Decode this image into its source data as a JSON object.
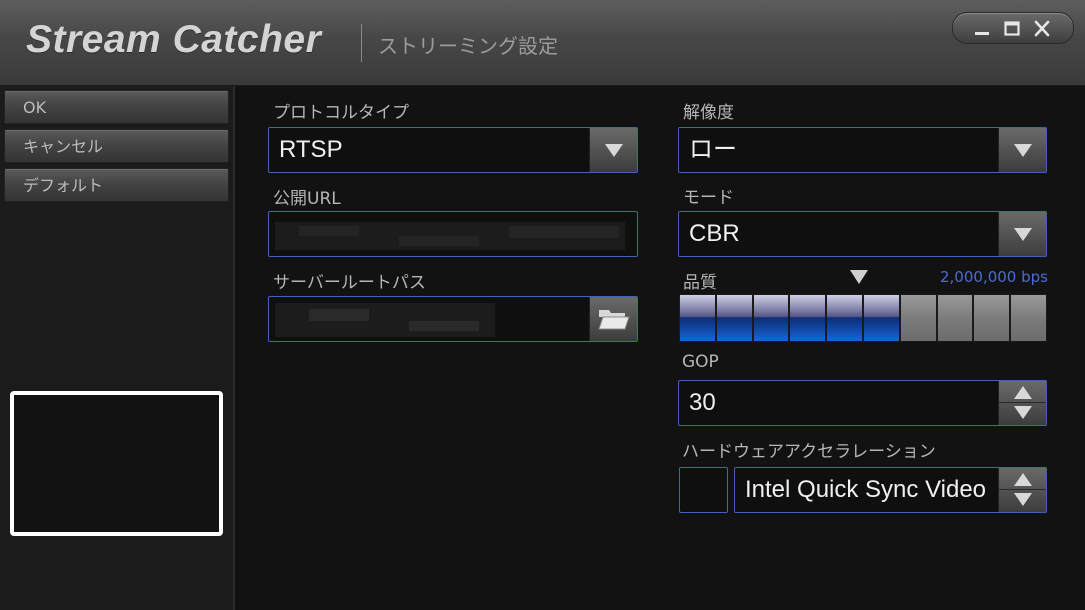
{
  "app": {
    "title": "Stream Catcher",
    "subtitle": "ストリーミング設定"
  },
  "window_controls": [
    "minimize-icon",
    "maximize-icon",
    "close-icon"
  ],
  "sidebar": {
    "ok_label": "OK",
    "cancel_label": "キャンセル",
    "default_label": "デフォルト"
  },
  "form": {
    "protocol": {
      "label": "プロトコルタイプ",
      "value": "RTSP"
    },
    "public_url": {
      "label": "公開URL",
      "value": ""
    },
    "server_root": {
      "label": "サーバールートパス",
      "value": ""
    },
    "resolution": {
      "label": "解像度",
      "value": "ロー"
    },
    "mode": {
      "label": "モード",
      "value": "CBR"
    },
    "quality": {
      "label": "品質",
      "bitrate": "2,000,000 bps",
      "level": 6,
      "max": 10
    },
    "gop": {
      "label": "GOP",
      "value": "30"
    },
    "hw_accel": {
      "label": "ハードウェアアクセラレーション",
      "value": "Intel Quick Sync Video"
    }
  },
  "colors": {
    "accent_border": "#4463b4",
    "bitrate_text": "#4a6cd0",
    "quality_on": "#1566d6"
  }
}
